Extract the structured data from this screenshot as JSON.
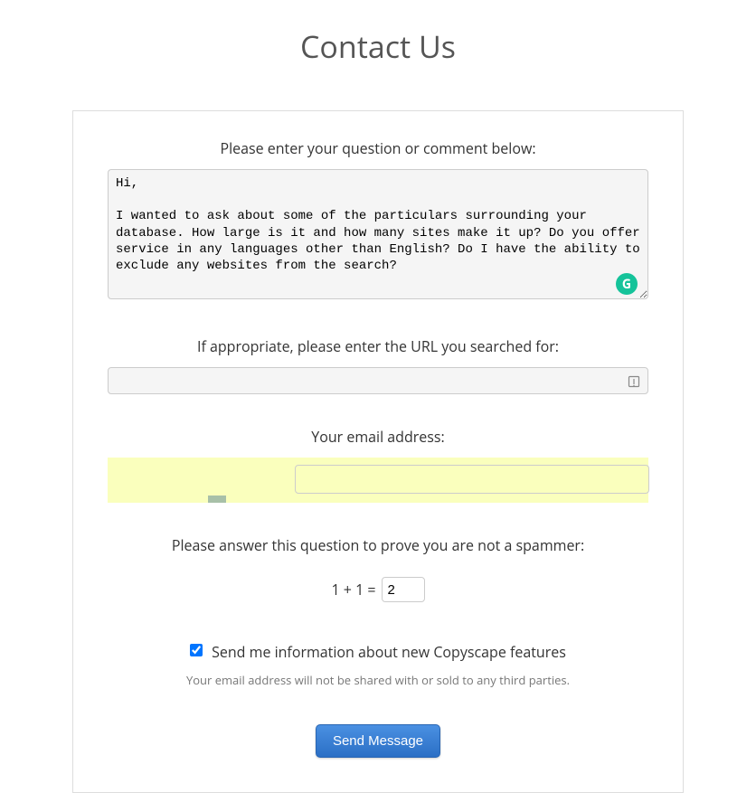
{
  "page": {
    "title": "Contact Us"
  },
  "form": {
    "question": {
      "label": "Please enter your question or comment below:",
      "value": "Hi,\n\nI wanted to ask about some of the particulars surrounding your database. How large is it and how many sites make it up? Do you offer service in any languages other than English? Do I have the ability to exclude any websites from the search?"
    },
    "url": {
      "label": "If appropriate, please enter the URL you searched for:",
      "value": ""
    },
    "email": {
      "label": "Your email address:",
      "value": ""
    },
    "spammer": {
      "label": "Please answer this question to prove you are not a spammer:",
      "question": "1 + 1 =",
      "value": "2"
    },
    "subscribe": {
      "label": "Send me information about new Copyscape features",
      "checked": true
    },
    "privacy_note": "Your email address will not be shared with or sold to any third parties.",
    "submit_label": "Send Message"
  },
  "icons": {
    "grammar_badge": "G"
  }
}
